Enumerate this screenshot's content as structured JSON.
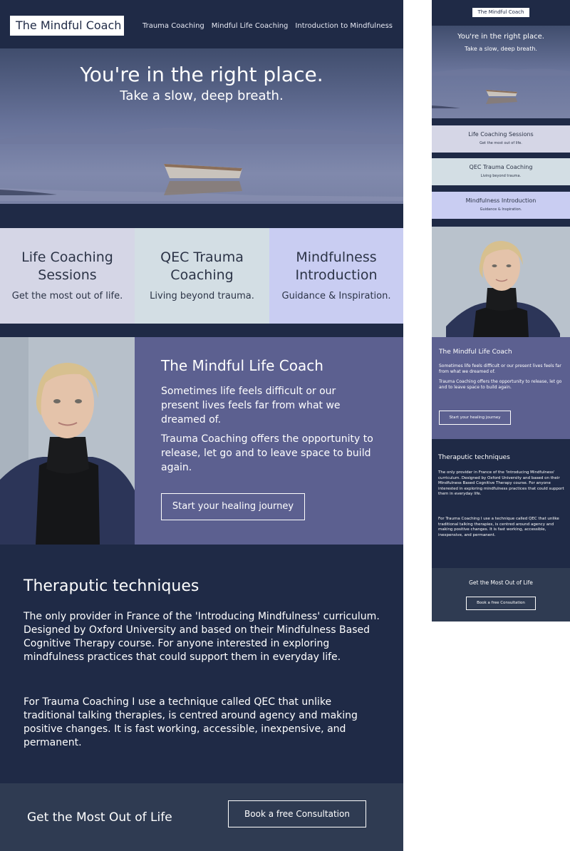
{
  "brand": {
    "logo_text": "The Mindful Coach"
  },
  "nav": {
    "links": [
      "Trauma Coaching",
      "Mindful Life Coaching",
      "Introduction to Mindfulness"
    ]
  },
  "hero": {
    "title": "You're in the right place.",
    "subtitle": "Take a slow, deep breath."
  },
  "services": [
    {
      "title": "Life Coaching Sessions",
      "subtitle": "Get the most out of life."
    },
    {
      "title": "QEC Trauma Coaching",
      "subtitle": "Living beyond trauma."
    },
    {
      "title": "Mindfulness Introduction",
      "subtitle": "Guidance & Inspiration."
    }
  ],
  "about": {
    "heading": "The Mindful Life Coach",
    "paragraph1": "Sometimes life feels difficult or our present lives feels far from what we dreamed of.",
    "paragraph2": "Trauma Coaching offers the opportunity to release, let go and to leave space to build again.",
    "button_label": "Start your healing journey"
  },
  "techniques": {
    "heading": "Theraputic techniques",
    "paragraph1": "The only provider in France of the 'Introducing Mindfulness' curriculum. Designed by Oxford University and based on their Mindfulness Based Cognitive Therapy course. For anyone interested in exploring mindfulness practices that could support them in everyday life.",
    "paragraph2": "For Trauma Coaching I use a technique called QEC that unlike traditional talking therapies, is centred around agency and making positive changes. It is fast working, accessible, inexpensive, and permanent."
  },
  "cta": {
    "heading": "Get the Most Out of Life",
    "button_label": "Book a free Consultation"
  },
  "colors": {
    "navy": "#1f2a46",
    "purple": "#5c6090",
    "slate": "#2f3b52",
    "card_lavender": "#d5d6e6",
    "card_grey_blue": "#d3dee4",
    "card_periwinkle": "#c9cdf2"
  }
}
